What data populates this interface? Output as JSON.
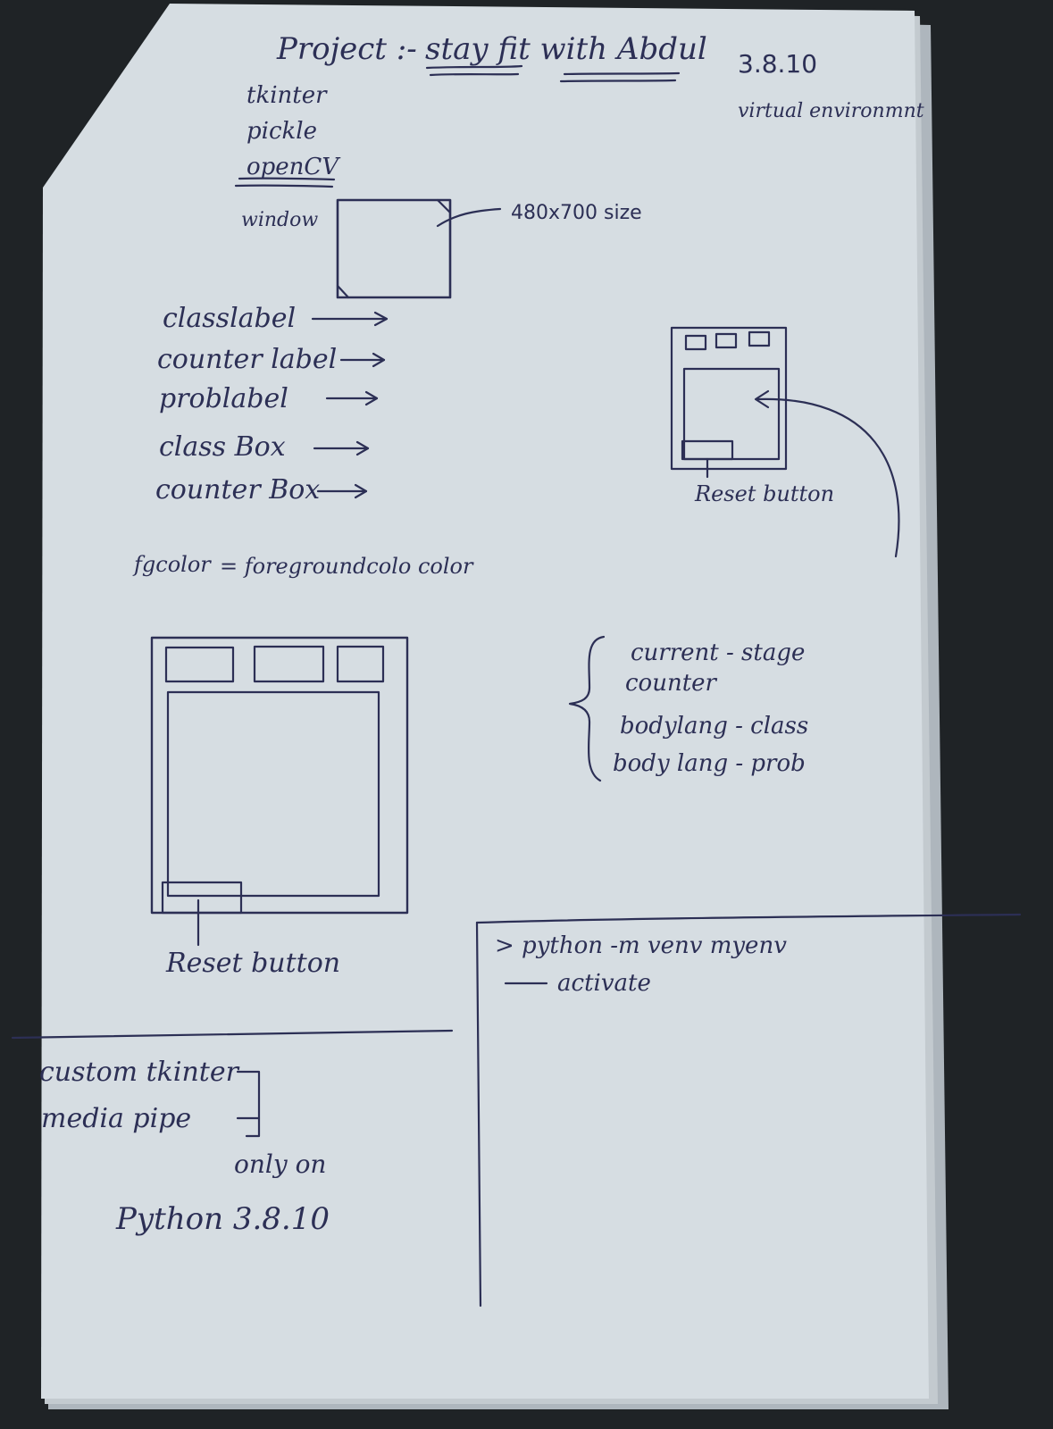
{
  "page": {
    "paper_color": "#d6dde2",
    "ink_color": "#2c2f55",
    "background_color": "#1f2326"
  },
  "header": {
    "project_label": "Project :-",
    "title": "stay fit with Abdul",
    "python_version": "3.8.10",
    "venv_note": "virtual environmnt"
  },
  "libraries": [
    "tkinter",
    "pickle",
    "openCV"
  ],
  "window_note": {
    "label": "window",
    "size": "480x700 size"
  },
  "widgets": [
    "classlabel",
    "counter label",
    "problabel",
    "class Box",
    "counter Box"
  ],
  "fg_note": {
    "key": "fgcolor",
    "value": "= foregroundcolo color"
  },
  "small_sketch": {
    "caption": "Reset button"
  },
  "large_sketch": {
    "caption": "Reset button"
  },
  "variables": [
    "current - stage",
    "counter",
    "bodylang - class",
    "body lang - prob"
  ],
  "commands": {
    "line1": "> python -m venv myenv",
    "line2": "activate"
  },
  "footer": {
    "libs": [
      "custom tkinter",
      "media pipe"
    ],
    "note": "only on",
    "python": "Python 3.8.10"
  }
}
